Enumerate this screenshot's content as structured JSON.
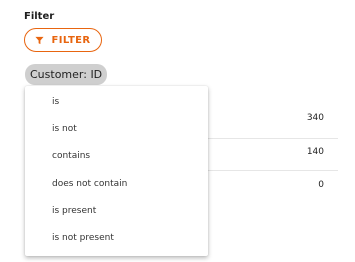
{
  "filter": {
    "heading": "Filter",
    "button_label": "FILTER",
    "button_icon": "funnel-icon",
    "accent_color": "#e8650f"
  },
  "chip": {
    "label": "Customer: ID"
  },
  "dropdown": {
    "options": [
      "is",
      "is not",
      "contains",
      "does not contain",
      "is present",
      "is not present"
    ]
  },
  "table": {
    "values": [
      "340",
      "140",
      "0"
    ]
  }
}
